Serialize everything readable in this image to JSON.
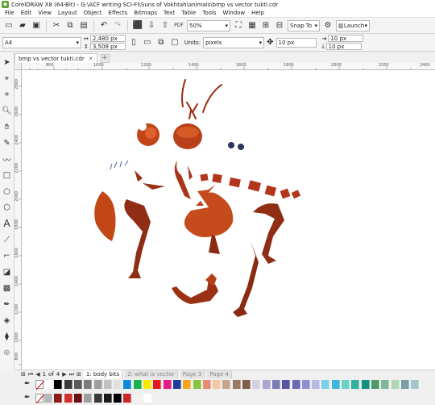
{
  "window": {
    "title": "CorelDRAW X8 (64-Bit) - G:\\ACF writing SCI-FI\\Suns of Vokhtah\\animals\\bmp vs vector tukti.cdr"
  },
  "menu": [
    "File",
    "Edit",
    "View",
    "Layout",
    "Object",
    "Effects",
    "Bitmaps",
    "Text",
    "Table",
    "Tools",
    "Window",
    "Help"
  ],
  "toolbar": {
    "zoom": "50%",
    "snap_to": "Snap To",
    "launch": "Launch"
  },
  "property_bar": {
    "page_size": "A4",
    "width": "2,480 px",
    "height": "3,508 px",
    "units_label": "Units:",
    "units": "pixels",
    "nudge": "10 px",
    "dup_x": "10 px",
    "dup_y": "10 px"
  },
  "document_tab": "bmp vs vector tukti.cdr",
  "ruler": {
    "top_ticks": [
      "800",
      "1000",
      "1200",
      "1400",
      "1600",
      "1800",
      "2000",
      "2200",
      "2400"
    ],
    "left_ticks": [
      "2800",
      "2600",
      "2400",
      "2200",
      "2000",
      "1800",
      "1600",
      "1400",
      "1200",
      "1000",
      "800"
    ]
  },
  "page_nav": {
    "current": "1",
    "of_label": "of",
    "total": "4",
    "tabs": [
      "1: body bits",
      "2: what is vector",
      "Page 3",
      "Page 4"
    ]
  },
  "palette": {
    "row1": [
      "#ffffff",
      "#000000",
      "#3a3a3a",
      "#5a5a5a",
      "#7c7c7c",
      "#9e9e9e",
      "#c2c2c2",
      "#e0e0e0",
      "#0a8ad8",
      "#1cb24a",
      "#ffe800",
      "#e8171a",
      "#e21a8c",
      "#1f3f9c",
      "#f7a51c",
      "#8ac541",
      "#ec8b73",
      "#f2c8a2",
      "#c6a58c",
      "#9a7861",
      "#7d5d48",
      "#d3d0e4",
      "#a9a6cf",
      "#7d7ab8",
      "#5856a0",
      "#6a69b6",
      "#8f8ed0",
      "#b8b9e4",
      "#7ed0e8",
      "#3db6d9",
      "#6ed0c7",
      "#2fb39f",
      "#129080",
      "#4e9a68",
      "#7fb898",
      "#aed7b3",
      "#7a9ea8",
      "#a5c4c9"
    ],
    "row2": [
      "#b8b8b8",
      "#8b1a1a",
      "#d0312d",
      "#6b0f11",
      "#9e9e9e",
      "#3a3a3a",
      "#1a1a1a",
      "#000000",
      "#c8282a",
      "#f0f0f0",
      "#ffffff"
    ]
  }
}
